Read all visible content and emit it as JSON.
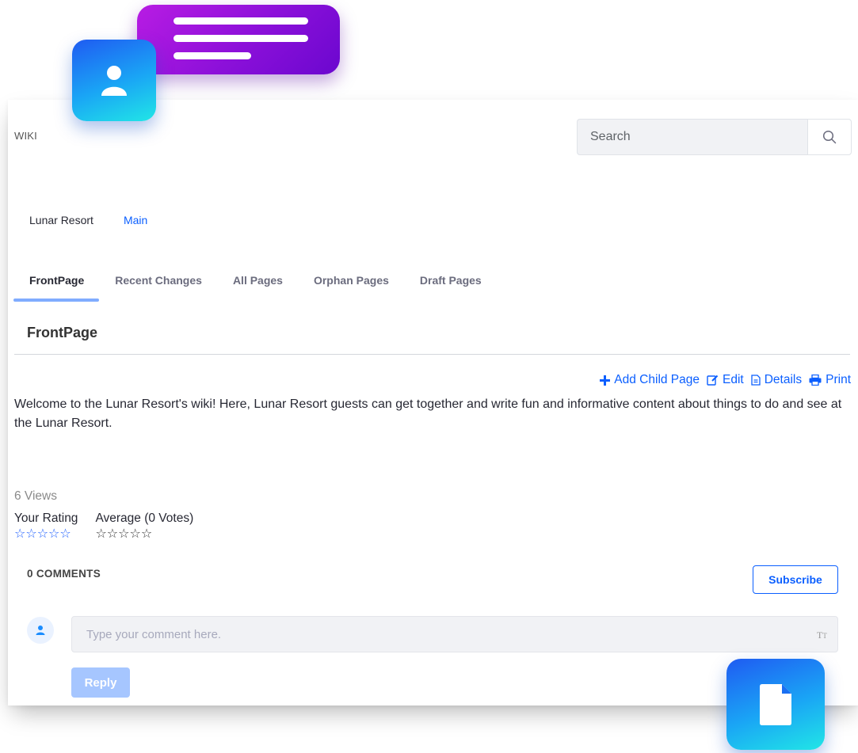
{
  "header": {
    "section_label": "WIKI",
    "search": {
      "placeholder": "Search",
      "value": ""
    }
  },
  "breadcrumb": {
    "site": "Lunar Resort",
    "node": "Main"
  },
  "tabs": [
    {
      "label": "FrontPage",
      "active": true
    },
    {
      "label": "Recent Changes",
      "active": false
    },
    {
      "label": "All Pages",
      "active": false
    },
    {
      "label": "Orphan Pages",
      "active": false
    },
    {
      "label": "Draft Pages",
      "active": false
    }
  ],
  "page": {
    "title": "FrontPage",
    "actions": {
      "add_child": "Add Child Page",
      "edit": "Edit",
      "details": "Details",
      "print": "Print"
    },
    "content": "Welcome to the Lunar Resort's wiki! Here, Lunar Resort guests can get together and write fun and informative content about things to do and see at the Lunar Resort.",
    "views": "6 Views"
  },
  "ratings": {
    "your_label": "Your Rating",
    "average_label": "Average (0 Votes)",
    "your_value": 0,
    "average_value": 0,
    "max": 5
  },
  "comments": {
    "count_label": "0 COMMENTS",
    "subscribe_label": "Subscribe",
    "placeholder": "Type your comment here.",
    "reply_label": "Reply"
  },
  "colors": {
    "accent": "#0b5fff",
    "tab_indicator": "#80acff",
    "reply_disabled": "#a6c6ff",
    "bubble": "#8b10d9",
    "tile": "#1aa6f5"
  },
  "icons": [
    "chat-bubble-icon",
    "user-tile-icon",
    "document-tile-icon",
    "search-icon",
    "plus-icon",
    "edit-icon",
    "details-icon",
    "print-icon",
    "star-icon",
    "user-avatar-icon",
    "text-format-icon"
  ]
}
